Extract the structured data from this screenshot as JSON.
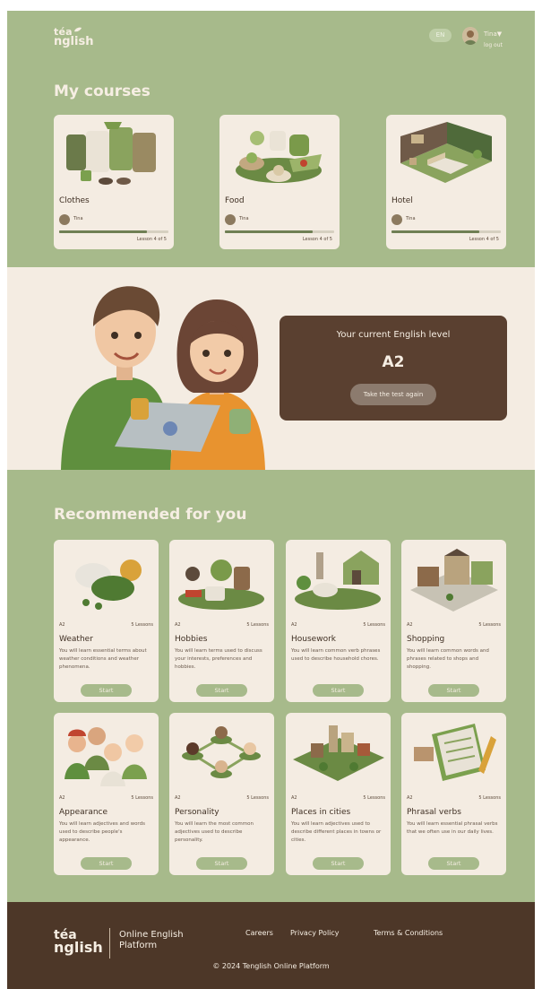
{
  "brand": {
    "logo_line1": "téa",
    "logo_line2": "nglish"
  },
  "header": {
    "language": "EN",
    "user_name": "Tina▼",
    "logout": "log out"
  },
  "my_courses": {
    "title": "My courses",
    "items": [
      {
        "title": "Clothes",
        "user": "Tina",
        "lesson": "Lesson 4 of 5",
        "progress": 0.8,
        "icon": "clothes-illustration"
      },
      {
        "title": "Food",
        "user": "Tina",
        "lesson": "Lesson 4 of 5",
        "progress": 0.8,
        "icon": "food-illustration"
      },
      {
        "title": "Hotel",
        "user": "Tina",
        "lesson": "Lesson 4 of 5",
        "progress": 0.8,
        "icon": "hotel-illustration"
      }
    ]
  },
  "level": {
    "label": "Your current English level",
    "value": "A2",
    "retake_button": "Take the test again"
  },
  "recommended": {
    "title": "Recommended for you",
    "items": [
      {
        "level": "A2",
        "lessons": "5 Lessons",
        "title": "Weather",
        "desc": "You will learn essential terms about weather conditions and weather phenomena.",
        "start": "Start"
      },
      {
        "level": "A2",
        "lessons": "5 Lessons",
        "title": "Hobbies",
        "desc": "You will learn terms used to discuss your interests, preferences and hobbies.",
        "start": "Start"
      },
      {
        "level": "A2",
        "lessons": "5 Lessons",
        "title": "Housework",
        "desc": "You will learn common verb phrases used to describe household chores.",
        "start": "Start"
      },
      {
        "level": "A2",
        "lessons": "5 Lessons",
        "title": "Shopping",
        "desc": "You will learn common words and phrases related to shops and shopping.",
        "start": "Start"
      },
      {
        "level": "A2",
        "lessons": "5 Lessons",
        "title": "Appearance",
        "desc": "You will learn adjectives and words used to describe people's appearance.",
        "start": "Start"
      },
      {
        "level": "A2",
        "lessons": "5 Lessons",
        "title": "Personality",
        "desc": "You will learn the most common adjectives used to describe personality.",
        "start": "Start"
      },
      {
        "level": "A2",
        "lessons": "5 Lessons",
        "title": "Places in cities",
        "desc": "You will learn adjectives used to describe different places in towns or cities.",
        "start": "Start"
      },
      {
        "level": "A2",
        "lessons": "5 Lessons",
        "title": "Phrasal verbs",
        "desc": "You will learn essential phrasal verbs that we often use in our daily lives.",
        "start": "Start"
      }
    ]
  },
  "footer": {
    "logo_line1": "téa",
    "logo_line2": "nglish",
    "platform": "Online English Platform",
    "links": [
      "Careers",
      "Privacy Policy",
      "Terms & Conditions"
    ],
    "copyright": "© 2024 Tenglish Online Platform"
  },
  "colors": {
    "green": "#a7ba8b",
    "beige": "#f4ece2",
    "brown": "#5a4030",
    "footer_brown": "#4d3728"
  }
}
